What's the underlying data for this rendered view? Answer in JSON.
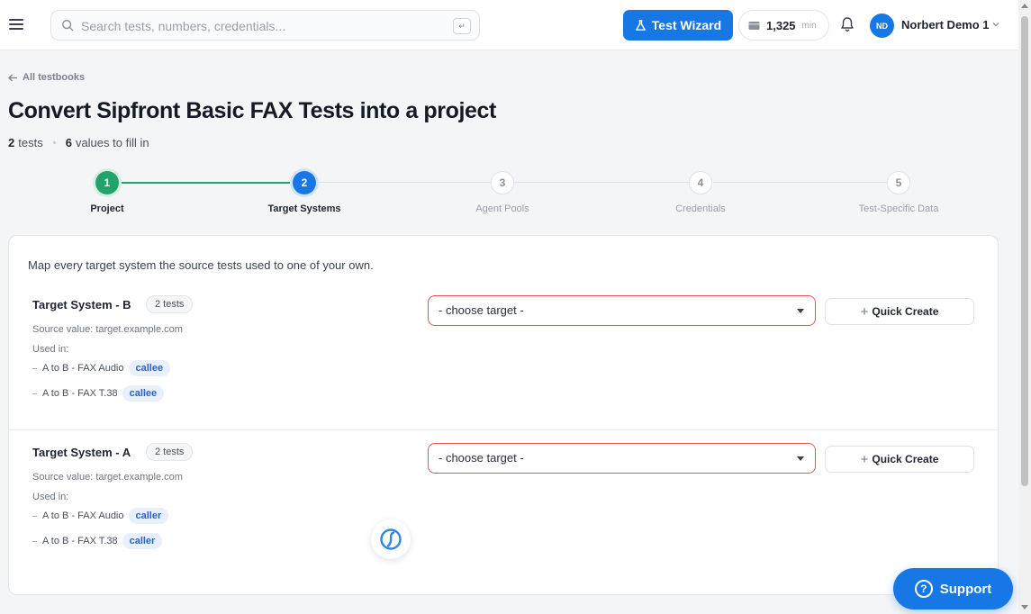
{
  "topbar": {
    "search_placeholder": "Search tests, numbers, credentials...",
    "search_shortcut": "↵",
    "wizard_label": "Test Wizard",
    "minutes_value": "1,325",
    "minutes_unit": "min",
    "avatar_initials": "ND",
    "user_name": "Norbert Demo 1"
  },
  "header": {
    "back_label": "All testbooks",
    "title": "Convert Sipfront Basic FAX Tests into a project",
    "tests_count": "2",
    "tests_label": "tests",
    "values_count": "6",
    "values_label": "values to fill in"
  },
  "stepper": {
    "steps": [
      {
        "number": "1",
        "label": "Project",
        "state": "done"
      },
      {
        "number": "2",
        "label": "Target Systems",
        "state": "active"
      },
      {
        "number": "3",
        "label": "Agent Pools",
        "state": "todo"
      },
      {
        "number": "4",
        "label": "Credentials",
        "state": "todo"
      },
      {
        "number": "5",
        "label": "Test-Specific Data",
        "state": "todo"
      }
    ]
  },
  "card": {
    "intro": "Map every target system the source tests used to one of your own.",
    "mappings": [
      {
        "title": "Target System - B",
        "count": "2 tests",
        "source_value": "Source value: target.example.com",
        "used_in_label": "Used in:",
        "usages": [
          {
            "test": "A to B - FAX Audio",
            "role": "callee"
          },
          {
            "test": "A to B - FAX T.38",
            "role": "callee"
          }
        ],
        "select_value": "- choose target -",
        "quick_create_label": "Quick Create"
      },
      {
        "title": "Target System - A",
        "count": "2 tests",
        "source_value": "Source value: target.example.com",
        "used_in_label": "Used in:",
        "usages": [
          {
            "test": "A to B - FAX Audio",
            "role": "caller"
          },
          {
            "test": "A to B - FAX T.38",
            "role": "caller"
          }
        ],
        "select_value": "- choose target -",
        "quick_create_label": "Quick Create"
      }
    ]
  },
  "support": {
    "label": "Support"
  },
  "colors": {
    "accent": "#1677e5",
    "success": "#21a36b",
    "error_border": "#e05656",
    "role_pill_bg": "#e8f0fd",
    "role_pill_text": "#2b62c7"
  },
  "icons": {
    "menu": "hamburger-icon",
    "search": "search-icon",
    "wizard": "flask-icon",
    "minutes": "wallet-icon",
    "bell": "bell-icon",
    "chevron": "chevron-down-icon",
    "back": "arrow-left-icon",
    "spinner": "sipfront-logo-icon",
    "support": "question-icon"
  }
}
